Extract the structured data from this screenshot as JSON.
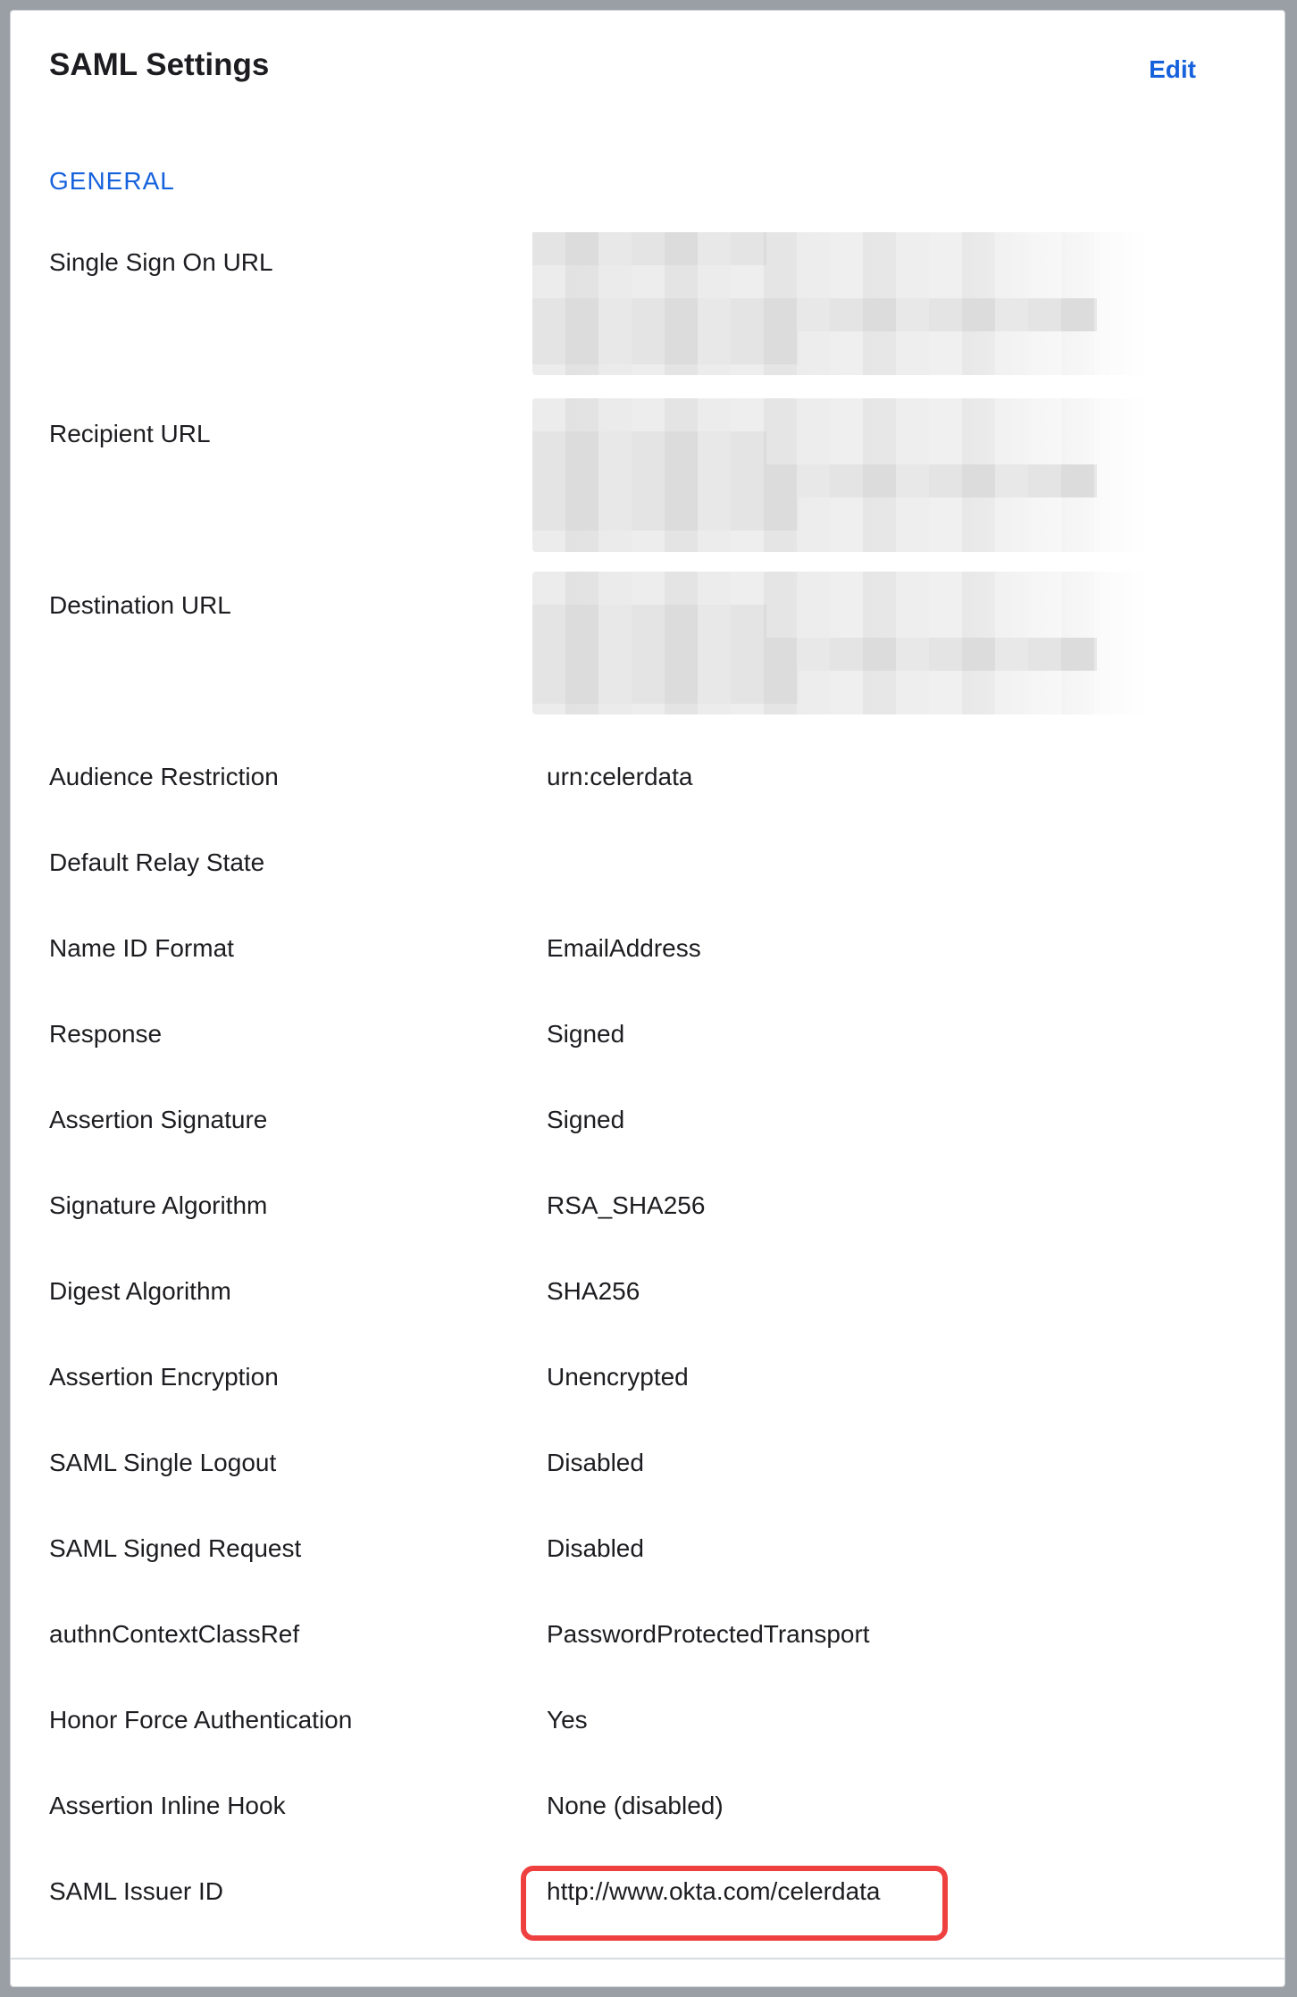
{
  "header": {
    "title": "SAML Settings",
    "edit_label": "Edit"
  },
  "section": {
    "heading": "GENERAL"
  },
  "fields": [
    {
      "label": "Single Sign On URL",
      "value": "",
      "redacted": true
    },
    {
      "label": "Recipient URL",
      "value": "",
      "redacted": true
    },
    {
      "label": "Destination URL",
      "value": "",
      "redacted": true
    },
    {
      "label": "Audience Restriction",
      "value": "urn:celerdata"
    },
    {
      "label": "Default Relay State",
      "value": ""
    },
    {
      "label": "Name ID Format",
      "value": "EmailAddress"
    },
    {
      "label": "Response",
      "value": "Signed"
    },
    {
      "label": "Assertion Signature",
      "value": "Signed"
    },
    {
      "label": "Signature Algorithm",
      "value": "RSA_SHA256"
    },
    {
      "label": "Digest Algorithm",
      "value": "SHA256"
    },
    {
      "label": "Assertion Encryption",
      "value": "Unencrypted"
    },
    {
      "label": "SAML Single Logout",
      "value": "Disabled"
    },
    {
      "label": "SAML Signed Request",
      "value": "Disabled"
    },
    {
      "label": "authnContextClassRef",
      "value": "PasswordProtectedTransport"
    },
    {
      "label": "Honor Force Authentication",
      "value": "Yes"
    },
    {
      "label": "Assertion Inline Hook",
      "value": "None (disabled)"
    },
    {
      "label": "SAML Issuer ID",
      "value": "http://www.okta.com/celerdata",
      "highlighted": true
    }
  ],
  "colors": {
    "accent": "#1662dd",
    "highlight": "#ef4040",
    "text": "#1d1d21"
  }
}
